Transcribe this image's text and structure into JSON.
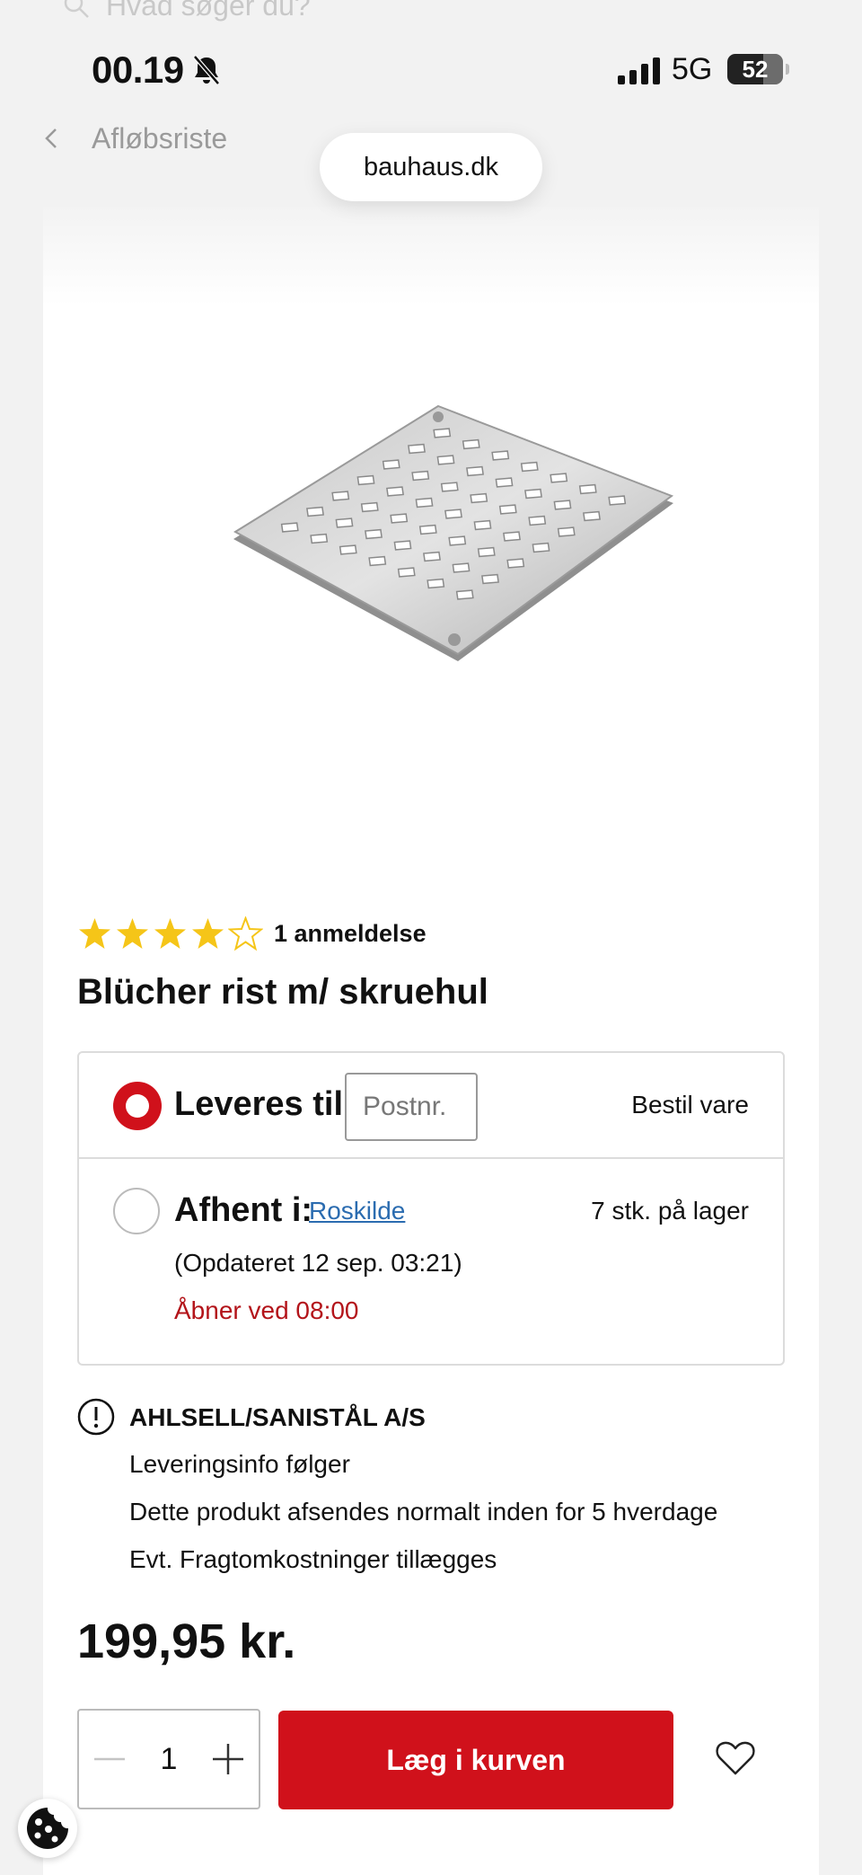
{
  "search": {
    "placeholder": "Hvad søger du?"
  },
  "status_bar": {
    "time": "00.19",
    "network": "5G",
    "battery": "52"
  },
  "breadcrumb": {
    "label": "Afløbsriste"
  },
  "browser": {
    "url": "bauhaus.dk"
  },
  "product": {
    "rating_value": 4,
    "rating_max": 5,
    "review_count_label": "1 anmeldelse",
    "title": "Blücher rist m/ skruehul",
    "price": "199,95 kr."
  },
  "delivery": {
    "deliver_label": "Leveres til:",
    "postal_placeholder": "Postnr.",
    "deliver_status": "Bestil vare",
    "pickup_label": "Afhent i:",
    "store_name": "Roskilde",
    "stock": "7 stk. på lager",
    "updated": "(Opdateret 12 sep. 03:21)",
    "opens": "Åbner ved 08:00"
  },
  "info": {
    "supplier": "AHLSELL/SANISTÅL A/S",
    "lines": [
      "Leveringsinfo følger",
      "Dette produkt afsendes normalt inden for 5 hverdage",
      "Evt. Fragtomkostninger tillægges"
    ]
  },
  "cart": {
    "quantity": "1",
    "add_label": "Læg i kurven"
  },
  "colors": {
    "accent": "#d0111b",
    "link": "#2b6cb0",
    "star": "#f5c518"
  }
}
